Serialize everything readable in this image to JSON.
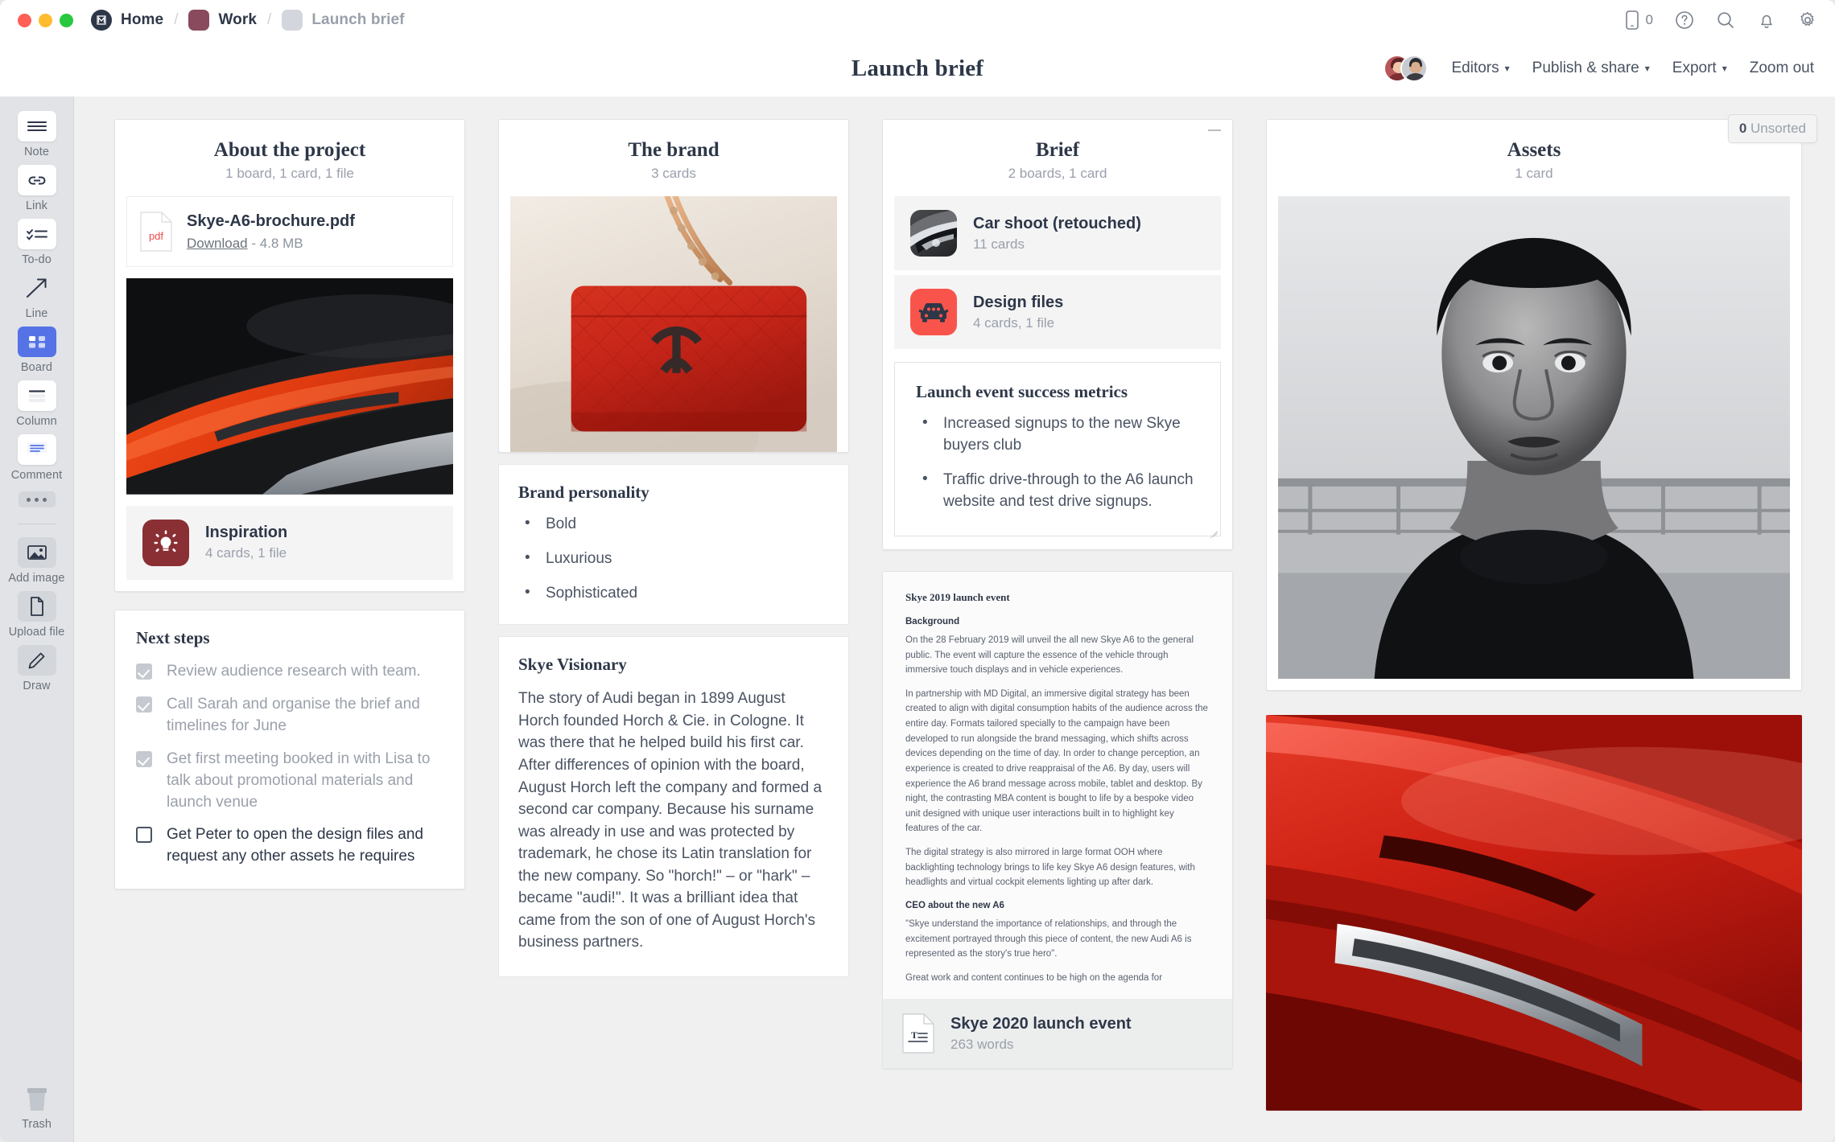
{
  "titlebar": {
    "breadcrumbs": [
      {
        "label": "Home",
        "icon": "milanote-logo-icon",
        "muted": false
      },
      {
        "label": "Work",
        "icon": "folder-swatch-icon",
        "muted": false
      },
      {
        "label": "Launch brief",
        "icon": "folder-swatch-icon",
        "muted": true
      }
    ],
    "separator": "/",
    "icons": [
      {
        "name": "mobile-icon",
        "count": "0"
      },
      {
        "name": "help-icon",
        "count": ""
      },
      {
        "name": "search-icon",
        "count": ""
      },
      {
        "name": "notifications-bell-icon",
        "count": ""
      },
      {
        "name": "settings-gear-icon",
        "count": ""
      }
    ]
  },
  "header": {
    "title": "Launch brief",
    "editors_label": "Editors",
    "publish_label": "Publish & share",
    "export_label": "Export",
    "zoom_out_label": "Zoom out"
  },
  "sidebar": {
    "tools": [
      {
        "label": "Note",
        "icon": "note-icon",
        "style": "white",
        "active": false
      },
      {
        "label": "Link",
        "icon": "link-icon",
        "style": "white",
        "active": false
      },
      {
        "label": "To-do",
        "icon": "todo-icon",
        "style": "white",
        "active": false
      },
      {
        "label": "Line",
        "icon": "line-arrow-icon",
        "style": "plain",
        "active": false
      },
      {
        "label": "Board",
        "icon": "board-icon",
        "style": "active",
        "active": true
      },
      {
        "label": "Column",
        "icon": "column-icon",
        "style": "white",
        "active": false
      },
      {
        "label": "Comment",
        "icon": "comment-icon",
        "style": "white",
        "active": false
      }
    ],
    "more_label": "more-options",
    "extras": [
      {
        "label": "Add image",
        "icon": "add-image-icon"
      },
      {
        "label": "Upload file",
        "icon": "upload-file-icon"
      },
      {
        "label": "Draw",
        "icon": "draw-pencil-icon"
      }
    ],
    "trash_label": "Trash",
    "active_color": "#5573e6"
  },
  "canvas": {
    "unsorted_count": "0",
    "unsorted_label": "Unsorted"
  },
  "columns": [
    {
      "id": "about-the-project",
      "title": "About the project",
      "subtitle": "1 board, 1 card, 1 file",
      "file": {
        "name": "Skye-A6-brochure.pdf",
        "download_label": "Download",
        "size": "4.8 MB",
        "badge": "pdf",
        "badge_color": "#ef4b4b"
      },
      "image_alt": "red-sports-car-rear-wing-photo",
      "tile": {
        "name": "Inspiration",
        "sub": "4 cards, 1 file",
        "icon": "lightbulb-icon",
        "color": "#8a2f33"
      },
      "todo": {
        "title": "Next steps",
        "items": [
          {
            "text": "Review audience research with team.",
            "done": true
          },
          {
            "text": "Call Sarah and organise the brief and timelines for June",
            "done": true
          },
          {
            "text": "Get first meeting booked in with Lisa to talk about promotional materials and launch venue",
            "done": true
          },
          {
            "text": "Get Peter to open the design files and request any other assets he requires",
            "done": false
          }
        ]
      }
    },
    {
      "id": "the-brand",
      "title": "The brand",
      "subtitle": "3 cards",
      "image_alt": "red-quilted-handbag-photo",
      "personality": {
        "title": "Brand personality",
        "items": [
          "Bold",
          "Luxurious",
          "Sophisticated"
        ]
      },
      "visionary": {
        "title": "Skye Visionary",
        "body": "The story of Audi began in 1899 August Horch founded Horch & Cie. in Cologne. It was there that he helped build his first car. After differences of opinion with the board, August Horch left the company and formed a second car company. Because his surname was already in use and was protected by trademark, he chose its Latin translation for the new company. So \"horch!\" – or \"hark\" – became \"audi!\". It was a brilliant idea that came from the son of one of August Horch's business partners."
      }
    },
    {
      "id": "brief",
      "title": "Brief",
      "subtitle": "2 boards, 1 card",
      "tiles": [
        {
          "name": "Car shoot (retouched)",
          "sub": "11 cards",
          "icon": "car-headlight-thumbnail",
          "color": "#3a3a3c"
        },
        {
          "name": "Design files",
          "sub": "4 cards, 1 file",
          "icon": "car-front-icon",
          "color": "#f9544b"
        }
      ],
      "metrics": {
        "title": "Launch event success metrics",
        "items": [
          "Increased signups to the new Skye buyers club",
          "Traffic drive-through to the A6 launch website and test drive signups."
        ]
      },
      "document": {
        "heading": "Skye 2019 launch event",
        "sections": [
          {
            "type": "h2",
            "text": "Background"
          },
          {
            "type": "p",
            "text": "On the 28 February 2019 will unveil the all new Skye A6 to the general public. The event will capture the essence of the vehicle through immersive touch displays and in vehicle experiences."
          },
          {
            "type": "p",
            "text": "In partnership with MD Digital, an immersive digital strategy has been created to align with digital consumption habits of the audience across the entire day. Formats tailored specially to the campaign have been developed to run alongside the brand messaging, which shifts across devices depending on the time of day. In order to change perception, an experience is created to drive reappraisal of the A6. By day, users will experience the A6 brand message across mobile, tablet and desktop. By night, the contrasting MBA content is bought to life by a bespoke video unit designed with unique user interactions built in to highlight key features of the car."
          },
          {
            "type": "p",
            "text": "The digital strategy is also mirrored in large format OOH where backlighting technology brings to life key Skye A6 design features, with headlights and virtual cockpit elements lighting up after dark."
          },
          {
            "type": "h2",
            "text": "CEO about the new A6"
          },
          {
            "type": "p",
            "text": "\"Skye understand the importance of relationships, and through the excitement portrayed through this piece of content, the new Audi A6 is represented as the story's true hero\"."
          },
          {
            "type": "p",
            "text": "Great work and content continues to be high on the agenda for"
          }
        ],
        "footer_name": "Skye 2020 launch event",
        "footer_sub": "263 words",
        "footer_icon": "text-document-icon"
      }
    },
    {
      "id": "assets",
      "title": "Assets",
      "subtitle": "1 card",
      "portrait_alt": "black-and-white-portrait-of-man-in-turtleneck",
      "photo_alt": "red-car-side-detail-photo"
    }
  ]
}
